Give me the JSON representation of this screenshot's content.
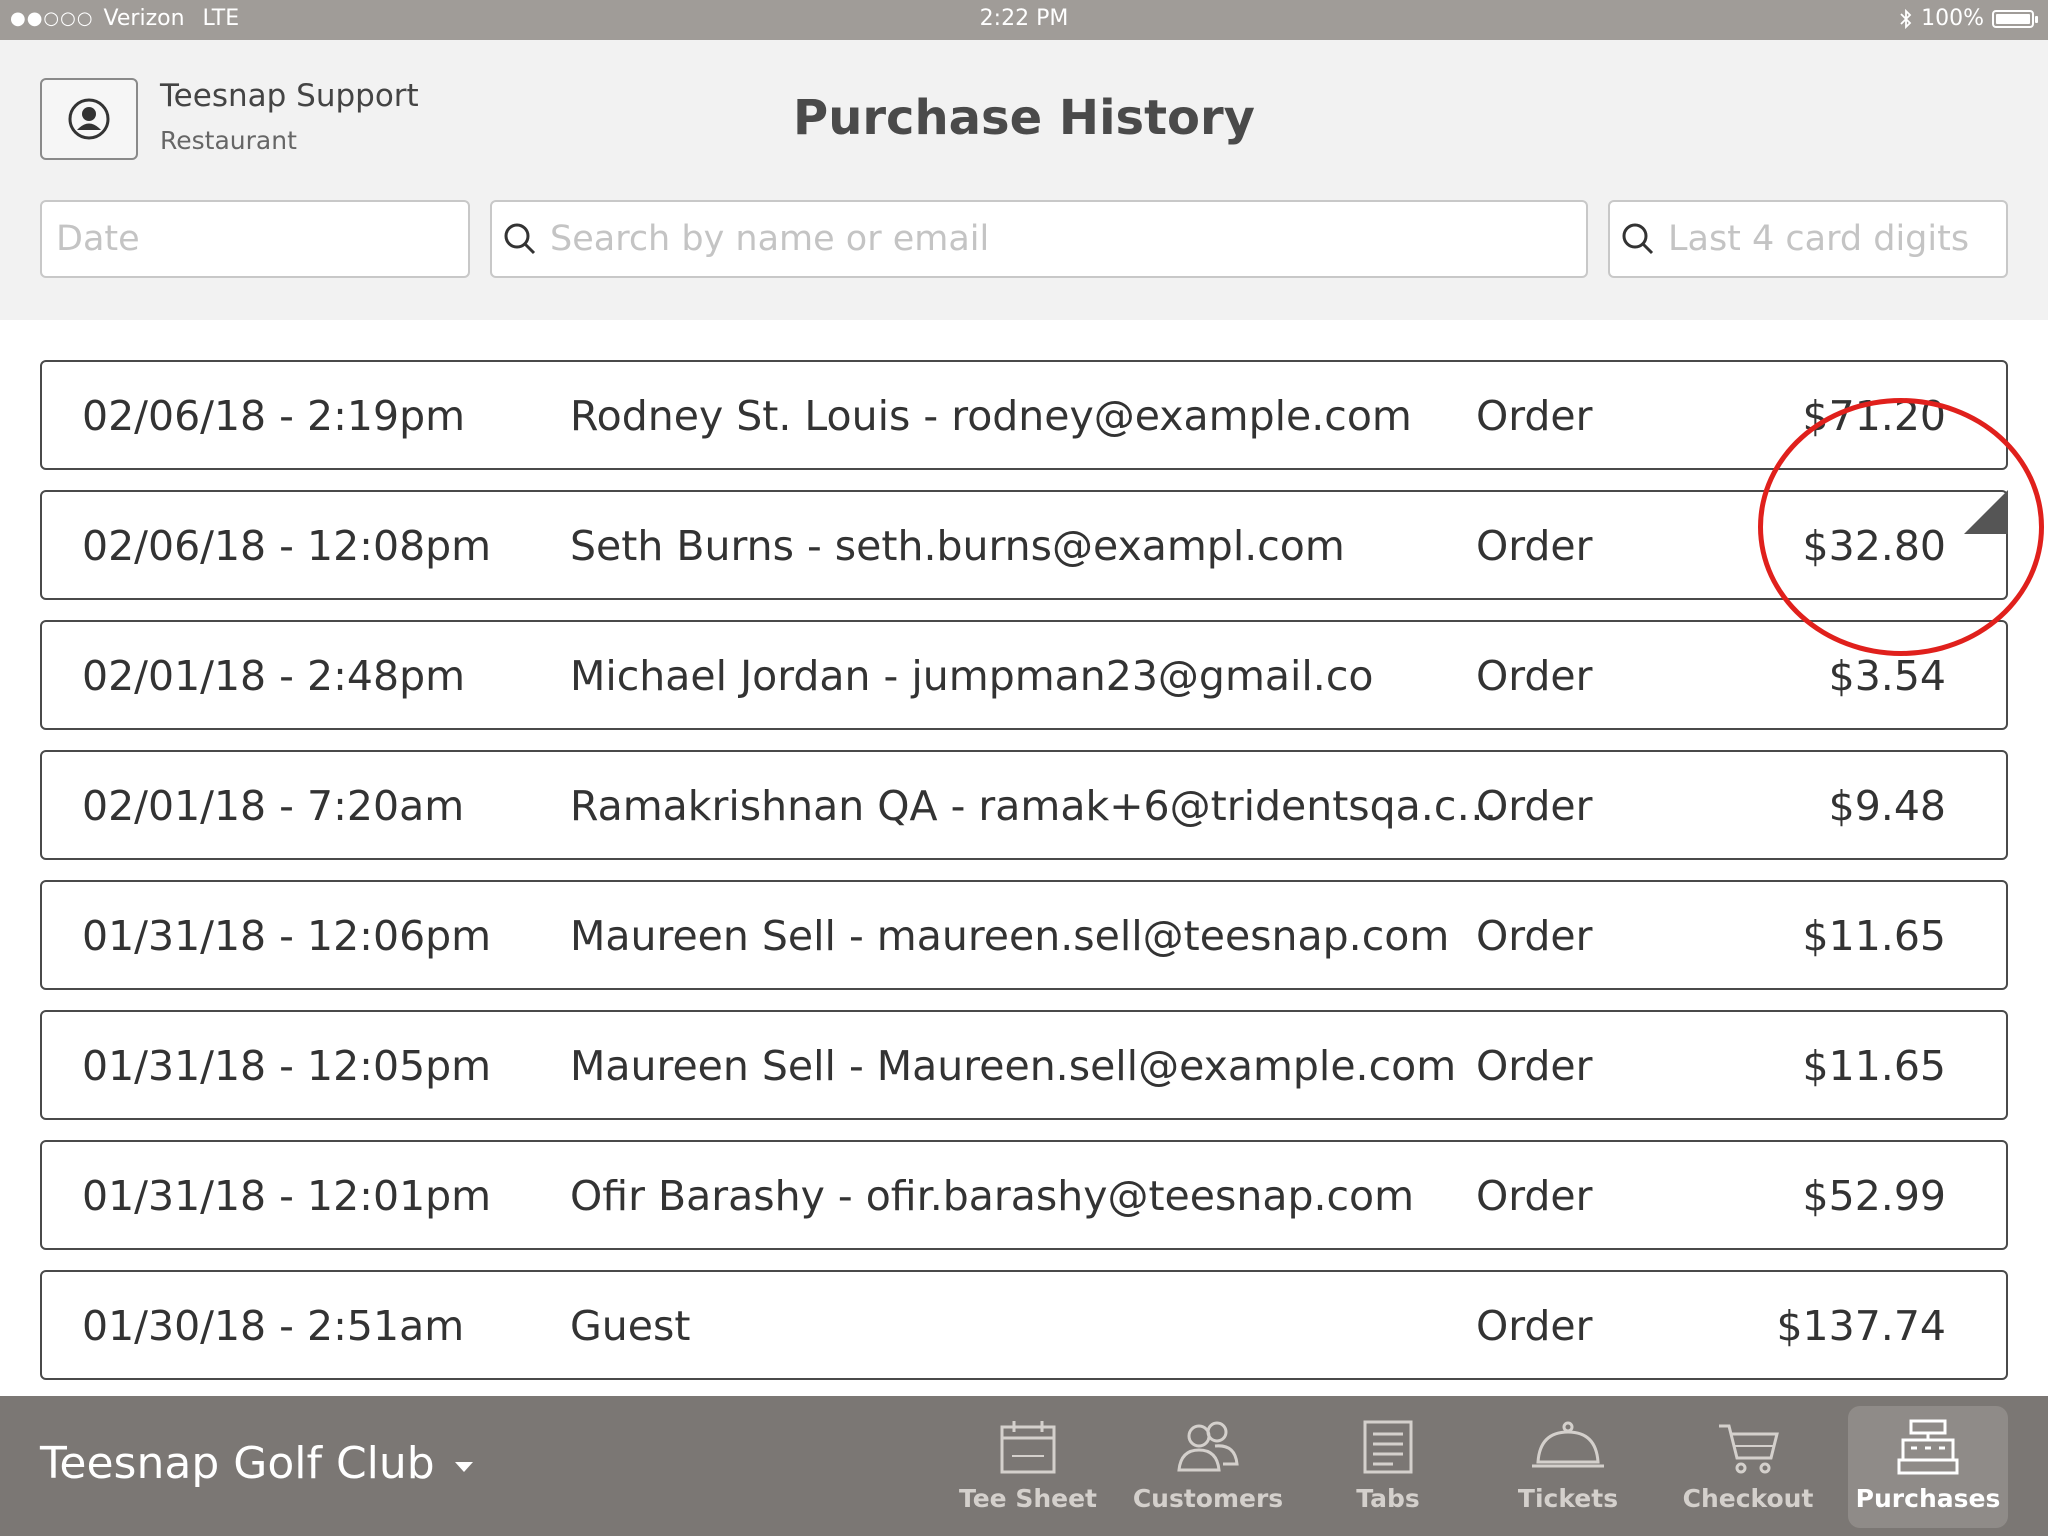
{
  "status_bar": {
    "signal": "●●○○○",
    "carrier": "Verizon",
    "network": "LTE",
    "time": "2:22 PM",
    "battery": "100%",
    "battery_level": 1.0
  },
  "header": {
    "user_name": "Teesnap Support",
    "user_role": "Restaurant",
    "title": "Purchase History"
  },
  "filters": {
    "date_placeholder": "Date",
    "search_placeholder": "Search by name or email",
    "card_placeholder": "Last 4 card digits"
  },
  "purchases": [
    {
      "date": "02/06/18 - 2:19pm",
      "customer": "Rodney St. Louis - rodney@example.com",
      "type": "Order",
      "amount": "$71.20"
    },
    {
      "date": "02/06/18 - 12:08pm",
      "customer": "Seth Burns - seth.burns@exampl.com",
      "type": "Order",
      "amount": "$32.80"
    },
    {
      "date": "02/01/18 - 2:48pm",
      "customer": "Michael Jordan - jumpman23@gmail.co",
      "type": "Order",
      "amount": "$3.54"
    },
    {
      "date": "02/01/18 - 7:20am",
      "customer": "Ramakrishnan QA - ramak+6@tridentsqa.c…",
      "type": "Order",
      "amount": "$9.48"
    },
    {
      "date": "01/31/18 - 12:06pm",
      "customer": "Maureen Sell - maureen.sell@teesnap.com",
      "type": "Order",
      "amount": "$11.65"
    },
    {
      "date": "01/31/18 - 12:05pm",
      "customer": "Maureen Sell - Maureen.sell@example.com",
      "type": "Order",
      "amount": "$11.65"
    },
    {
      "date": "01/31/18 - 12:01pm",
      "customer": "Ofir Barashy - ofir.barashy@teesnap.com",
      "type": "Order",
      "amount": "$52.99"
    },
    {
      "date": "01/30/18 - 2:51am",
      "customer": "Guest",
      "type": "Order",
      "amount": "$137.74"
    }
  ],
  "annotation_color": "#e0201c",
  "bottom_bar": {
    "club_name": "Teesnap Golf Club",
    "tabs": [
      {
        "label": "Tee Sheet",
        "icon": "calendar-icon"
      },
      {
        "label": "Customers",
        "icon": "users-icon"
      },
      {
        "label": "Tabs",
        "icon": "receipt-icon"
      },
      {
        "label": "Tickets",
        "icon": "cloche-icon"
      },
      {
        "label": "Checkout",
        "icon": "cart-icon"
      },
      {
        "label": "Purchases",
        "icon": "register-icon",
        "active": true
      }
    ]
  }
}
